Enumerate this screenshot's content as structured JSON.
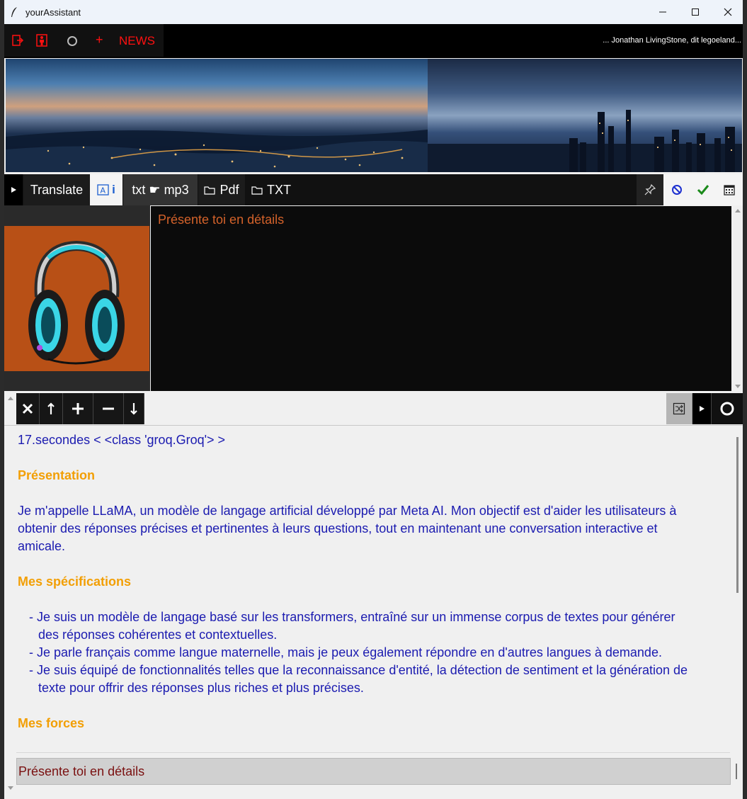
{
  "window": {
    "title": "yourAssistant"
  },
  "topbar": {
    "plus_label": "+",
    "news_label": "NEWS",
    "ticker_text": "... Jonathan LivingStone, dit legoeland..."
  },
  "tabs": {
    "translate": "Translate",
    "info_suffix": "i",
    "txt_mp3": "txt ☛ mp3",
    "pdf": "Pdf",
    "txt": "TXT"
  },
  "prompt": {
    "text": "Présente toi en détails"
  },
  "response": {
    "meta": "17.secondes < <class 'groq.Groq'> >",
    "heading1": "Présentation",
    "paragraph1_line1": "Je m'appelle LLaMA, un modèle de langage artificial développé par Meta AI. Mon objectif est d'aider les utilisateurs à",
    "paragraph1_line2": "obtenir des réponses précises et pertinentes à leurs questions, tout en maintenant une conversation interactive et",
    "paragraph1_line3": "amicale.",
    "heading2": "Mes spécifications",
    "bullet1_line1": "- Je suis un modèle de langage basé sur les transformers, entraîné sur un immense corpus de textes pour générer",
    "bullet1_line2": "des réponses cohérentes et contextuelles.",
    "bullet2_line1": "- Je parle français comme langue maternelle, mais je peux également répondre en d'autres langues à demande.",
    "bullet3_line1": "- Je suis équipé de fonctionnalités telles que la reconnaissance d'entité, la détection de sentiment et la génération de",
    "bullet3_line2": "texte pour offrir des réponses plus riches et plus précises.",
    "heading3": "Mes forces"
  },
  "input": {
    "text": "Présente toi en détails"
  },
  "colors": {
    "accent_red": "#ff1010",
    "heading_orange": "#f29f05",
    "body_blue": "#1b1bb0",
    "prompt_orange": "#d4622a",
    "image_bg": "#b85016"
  },
  "icons": [
    "feather-icon",
    "minimize-icon",
    "maximize-icon",
    "close-icon",
    "exit-icon",
    "person-icon",
    "circle-icon",
    "play-icon",
    "font-icon",
    "folder-icon",
    "pin-icon",
    "forbidden-icon",
    "checkmark-icon",
    "calendar-icon",
    "x-icon",
    "arrow-up-icon",
    "plus-icon",
    "minus-icon",
    "arrow-down-icon",
    "shuffle-icon",
    "record-icon",
    "headphones-image"
  ]
}
